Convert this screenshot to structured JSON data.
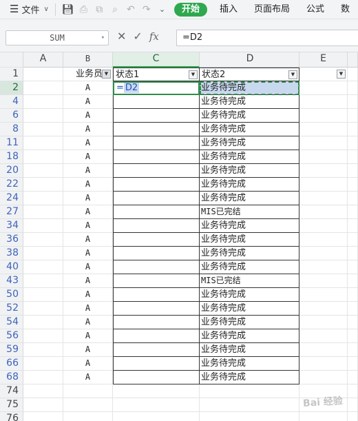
{
  "toolbar": {
    "file_menu": "文件",
    "tabs": [
      "开始",
      "插入",
      "页面布局",
      "公式",
      "数"
    ]
  },
  "formula_bar": {
    "name_box": "SUM",
    "formula": "=D2"
  },
  "columns": [
    "A",
    "B",
    "C",
    "D",
    "E"
  ],
  "header_row": {
    "row_num": "1",
    "B": "业务员",
    "C": "状态1",
    "D": "状态2"
  },
  "active_cell": {
    "address": "C2",
    "content_prefix": "=",
    "content_ref": "D2"
  },
  "rows": [
    {
      "num": "2",
      "B": "A",
      "D": "业务待完成"
    },
    {
      "num": "4",
      "B": "A",
      "D": "业务待完成"
    },
    {
      "num": "6",
      "B": "A",
      "D": "业务待完成"
    },
    {
      "num": "8",
      "B": "A",
      "D": "业务待完成"
    },
    {
      "num": "11",
      "B": "A",
      "D": "业务待完成"
    },
    {
      "num": "18",
      "B": "A",
      "D": "业务待完成"
    },
    {
      "num": "20",
      "B": "A",
      "D": "业务待完成"
    },
    {
      "num": "22",
      "B": "A",
      "D": "业务待完成"
    },
    {
      "num": "24",
      "B": "A",
      "D": "业务待完成"
    },
    {
      "num": "27",
      "B": "A",
      "D": "MIS已完结"
    },
    {
      "num": "34",
      "B": "A",
      "D": "业务待完成"
    },
    {
      "num": "36",
      "B": "A",
      "D": "业务待完成"
    },
    {
      "num": "38",
      "B": "A",
      "D": "业务待完成"
    },
    {
      "num": "40",
      "B": "A",
      "D": "业务待完成"
    },
    {
      "num": "43",
      "B": "A",
      "D": "MIS已完结"
    },
    {
      "num": "50",
      "B": "A",
      "D": "业务待完成"
    },
    {
      "num": "52",
      "B": "A",
      "D": "业务待完成"
    },
    {
      "num": "54",
      "B": "A",
      "D": "业务待完成"
    },
    {
      "num": "56",
      "B": "A",
      "D": "业务待完成"
    },
    {
      "num": "59",
      "B": "A",
      "D": "业务待完成"
    },
    {
      "num": "66",
      "B": "A",
      "D": "业务待完成"
    },
    {
      "num": "68",
      "B": "A",
      "D": "业务待完成"
    }
  ],
  "empty_rows": [
    "74",
    "75",
    "76"
  ],
  "watermark": "Bai 经验",
  "colors": {
    "accent_green": "#2fa84f",
    "row_number_blue": "#3d63b9",
    "selection_blue": "#c8d8ee"
  }
}
